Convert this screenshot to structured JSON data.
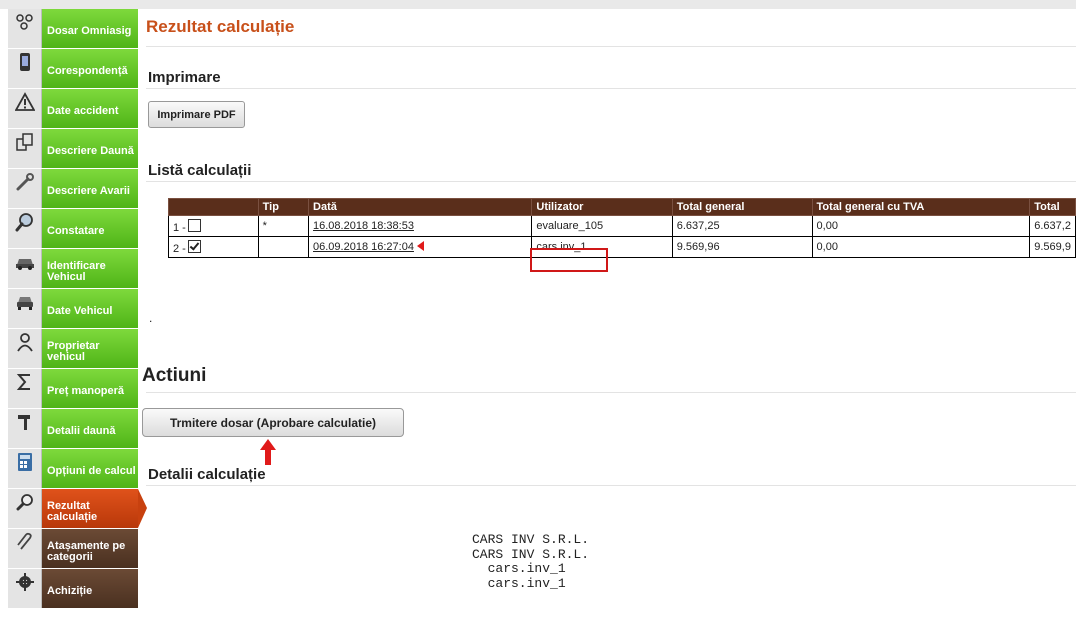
{
  "sidebar": {
    "items": [
      {
        "icon": "network-nodes-icon",
        "label": "Dosar Omniasig"
      },
      {
        "icon": "mobile-phone-icon",
        "label": "Corespondență"
      },
      {
        "icon": "warning-icon",
        "label": "Date accident"
      },
      {
        "icon": "copy-documents-icon",
        "label": "Descriere Daună"
      },
      {
        "icon": "wrench-icon",
        "label": "Descriere Avarii"
      },
      {
        "icon": "magnifier-icon",
        "label": "Constatare"
      },
      {
        "icon": "car-icon",
        "label": "Identificare Vehicul"
      },
      {
        "icon": "car-front-icon",
        "label": "Date Vehicul"
      },
      {
        "icon": "person-icon",
        "label": "Proprietar vehicul"
      },
      {
        "icon": "sigma-icon",
        "label": "Preț manoperă"
      },
      {
        "icon": "hammer-icon",
        "label": "Detalii daună"
      },
      {
        "icon": "calculator-icon",
        "label": "Opțiuni de calcul"
      },
      {
        "icon": "search-doc-icon",
        "label": "Rezultat calculație"
      },
      {
        "icon": "paperclip-icon",
        "label": "Atașamente pe categorii"
      },
      {
        "icon": "gear-icon",
        "label": "Achiziție"
      }
    ],
    "active_index": 12
  },
  "page": {
    "title": "Rezultat calculație",
    "print_section": "Imprimare",
    "print_button": "Imprimare PDF",
    "list_section": "Listă calculații",
    "dot": ".",
    "actions_section": "Actiuni",
    "send_button": "Trmitere dosar (Aprobare calculatie)",
    "details_section": "Detalii calculație"
  },
  "table": {
    "headers": [
      "",
      "Tip",
      "Dată",
      "Utilizator",
      "Total general",
      "Total general cu TVA",
      "Total"
    ],
    "rows": [
      {
        "index": "1 -",
        "checked": false,
        "tip": "*",
        "date": "16.08.2018 18:38:53",
        "user": "evaluare_105",
        "total": "6.637,25",
        "total_tva": "0,00",
        "total2": "6.637,2"
      },
      {
        "index": "2 -",
        "checked": true,
        "tip": "",
        "date": "06.09.2018 16:27:04",
        "user": "cars.inv_1",
        "total": "9.569,96",
        "total_tva": "0,00",
        "total2": "9.569,9"
      }
    ]
  },
  "details": {
    "lines": [
      "CARS INV S.R.L.",
      "",
      "CARS INV S.R.L.",
      "  cars.inv_1",
      "  cars.inv_1"
    ]
  },
  "colors": {
    "accent": "#c8501a",
    "sidebar_green": "#5cc023",
    "sidebar_active": "#c8410f",
    "table_header": "#5a2e1b",
    "annotation_red": "#d01818"
  }
}
